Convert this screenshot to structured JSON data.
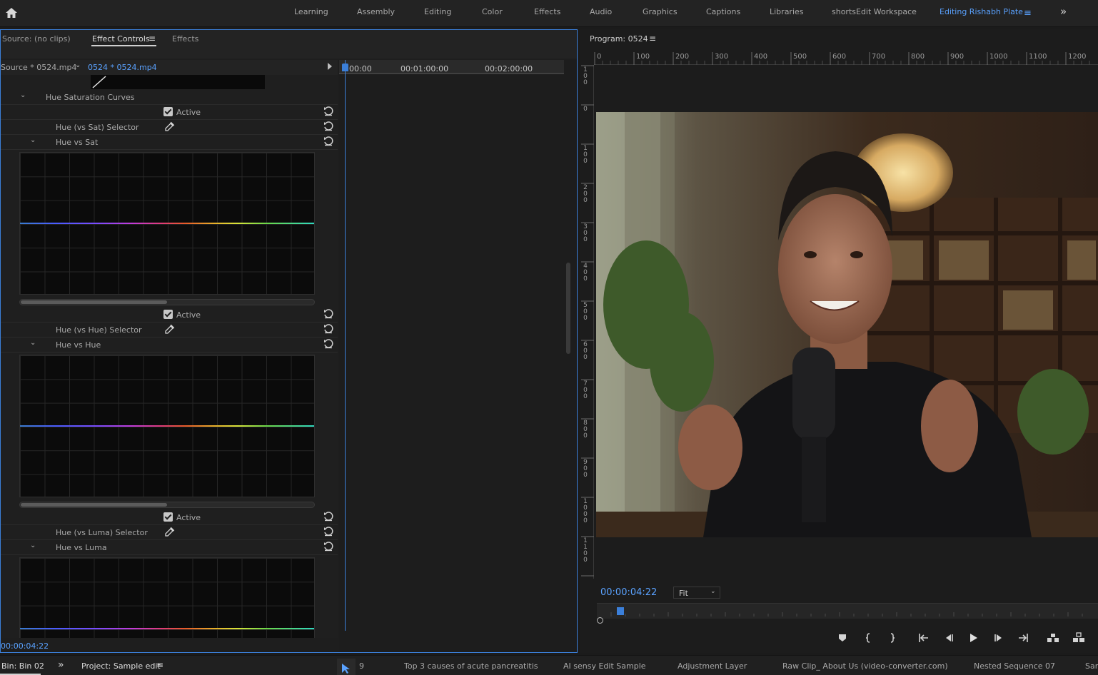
{
  "workspaces": {
    "items": [
      "Learning",
      "Assembly",
      "Editing",
      "Color",
      "Effects",
      "Audio",
      "Graphics",
      "Captions",
      "Libraries",
      "shortsEdit Workspace",
      "Editing Rishabh Plate"
    ],
    "active": "Editing Rishabh Plate",
    "more_glyph": "»",
    "menu_glyph": "≡"
  },
  "effect_panel": {
    "tabs": [
      "Source: (no clips)",
      "Effect Controls",
      "Effects"
    ],
    "active_tab": "Effect Controls",
    "menu_glyph": "≡",
    "source_label": "Source * 0524.mp4",
    "sequence_label": "0524 * 0524.mp4",
    "section_title": "Hue Saturation Curves",
    "curve_groups": [
      {
        "active_label": "Active",
        "selector_label": "Hue (vs Sat) Selector",
        "curve_label": "Hue vs Sat",
        "active_checked": true
      },
      {
        "active_label": "Active",
        "selector_label": "Hue (vs Hue) Selector",
        "curve_label": "Hue vs Hue",
        "active_checked": true
      },
      {
        "active_label": "Active",
        "selector_label": "Hue (vs Luma) Selector",
        "curve_label": "Hue vs Luma",
        "active_checked": true
      }
    ],
    "timecode": "00:00:04:22",
    "timeline_ticks": [
      "00:00",
      "00:01:00:00",
      "00:02:00:00"
    ]
  },
  "program_monitor": {
    "title": "Program: 0524",
    "menu_glyph": "≡",
    "h_ruler": [
      "0",
      "100",
      "200",
      "300",
      "400",
      "500",
      "600",
      "700",
      "800",
      "900",
      "1000",
      "1100",
      "1200"
    ],
    "v_ruler": [
      "100",
      "0",
      "100",
      "200",
      "300",
      "400",
      "500",
      "600",
      "700",
      "800",
      "900",
      "1000",
      "1100"
    ],
    "timecode": "00:00:04:22",
    "fit": "Fit",
    "controls": [
      "marker-icon",
      "mark-in-icon",
      "mark-out-icon",
      "go-to-in-icon",
      "step-back-icon",
      "play-icon",
      "step-forward-icon",
      "go-to-out-icon",
      "lift-icon",
      "extract-icon"
    ]
  },
  "bottom_bar": {
    "bin_tab": "Bin: Bin 02",
    "more_glyph": "»",
    "project_tab": "Project: Sample edit",
    "menu_glyph": "≡",
    "partial_text": "9",
    "sequences": [
      "Top 3 causes of acute pancreatitis",
      "AI sensy Edit Sample",
      "Adjustment Layer",
      "Raw Clip_ About Us (video-converter.com)",
      "Nested Sequence 07",
      "Sar"
    ]
  }
}
